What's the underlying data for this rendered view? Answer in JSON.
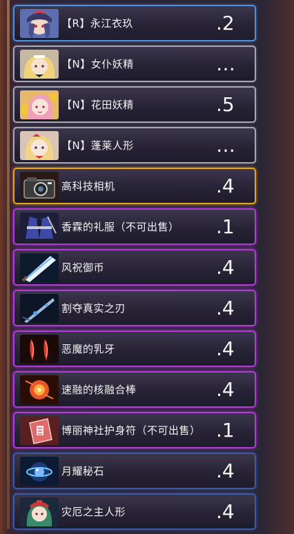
{
  "items": [
    {
      "label": "【R】永江衣玖",
      "value": ".2",
      "rarity": "blue",
      "icon": "portrait-iku-icon"
    },
    {
      "label": "【N】女仆妖精",
      "value": "…",
      "rarity": "silver",
      "icon": "portrait-maid-fairy-icon"
    },
    {
      "label": "【N】花田妖精",
      "value": ".5",
      "rarity": "silver",
      "icon": "portrait-flower-fairy-icon"
    },
    {
      "label": "【N】蓬莱人形",
      "value": "…",
      "rarity": "silver",
      "icon": "portrait-hourai-doll-icon"
    },
    {
      "label": "高科技相机",
      "value": ".4",
      "rarity": "gold",
      "icon": "camera-icon"
    },
    {
      "label": "香霖的礼服（不可出售）",
      "value": ".1",
      "rarity": "purple",
      "icon": "robe-icon"
    },
    {
      "label": "风祝御币",
      "value": ".4",
      "rarity": "purple",
      "icon": "gohei-icon"
    },
    {
      "label": "割夺真实之刃",
      "value": ".4",
      "rarity": "purple",
      "icon": "blade-icon"
    },
    {
      "label": "恶魔的乳牙",
      "value": ".4",
      "rarity": "purple",
      "icon": "fang-icon"
    },
    {
      "label": "速融的核融合棒",
      "value": ".4",
      "rarity": "purple",
      "icon": "fusion-rod-icon"
    },
    {
      "label": "博丽神社护身符（不可出售）",
      "value": ".1",
      "rarity": "purple",
      "icon": "amulet-icon"
    },
    {
      "label": "月耀秘石",
      "value": ".4",
      "rarity": "indigo",
      "icon": "moon-stone-icon"
    },
    {
      "label": "灾厄之主人形",
      "value": ".4",
      "rarity": "indigo",
      "icon": "hina-doll-icon"
    }
  ]
}
